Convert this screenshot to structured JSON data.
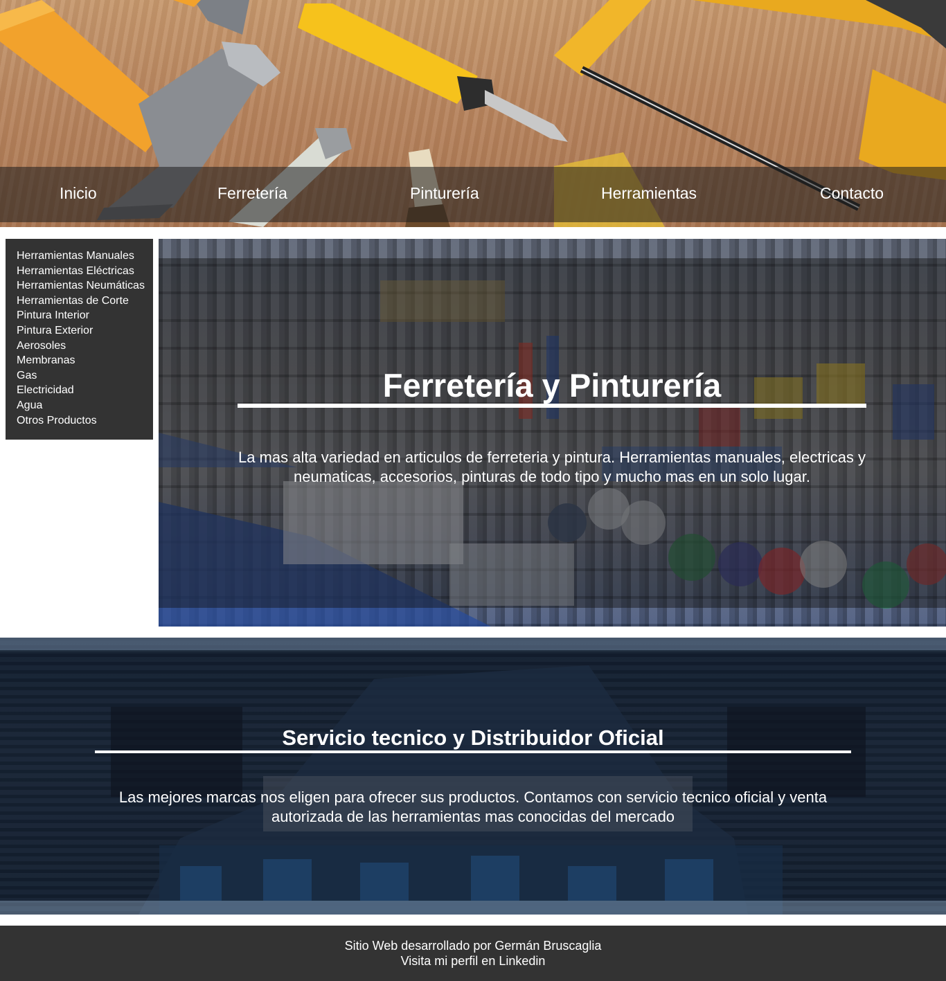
{
  "nav": {
    "items": [
      {
        "label": "Inicio"
      },
      {
        "label": "Ferretería"
      },
      {
        "label": "Pinturería"
      },
      {
        "label": "Herramientas"
      },
      {
        "label": "Contacto"
      }
    ]
  },
  "sidebar": {
    "items": [
      {
        "label": "Herramientas Manuales"
      },
      {
        "label": "Herramientas Eléctricas"
      },
      {
        "label": "Herramientas Neumáticas"
      },
      {
        "label": "Herramientas de Corte"
      },
      {
        "label": "Pintura Interior"
      },
      {
        "label": "Pintura Exterior"
      },
      {
        "label": "Aerosoles"
      },
      {
        "label": "Membranas"
      },
      {
        "label": "Gas"
      },
      {
        "label": "Electricidad"
      },
      {
        "label": "Agua"
      },
      {
        "label": "Otros Productos"
      }
    ]
  },
  "hero": {
    "title": "Ferretería y Pinturería",
    "text": "La mas alta variedad en articulos de ferreteria y pintura. Herramientas manuales, electricas y neumaticas, accesorios, pinturas de todo tipo y mucho mas en un solo lugar."
  },
  "service": {
    "title": "Servicio tecnico y Distribuidor Oficial",
    "text": "Las mejores marcas nos eligen para ofrecer sus productos. Contamos con servicio tecnico oficial y venta autorizada de las herramientas mas conocidas del mercado"
  },
  "footer": {
    "credit": "Sitio Web desarrollado por Germán Bruscaglia",
    "link": "Visita mi perfil en Linkedin"
  },
  "colors": {
    "panel": "#333333",
    "tool_handle": "#f5a623",
    "screwdriver_yellow": "#f6c21c"
  }
}
